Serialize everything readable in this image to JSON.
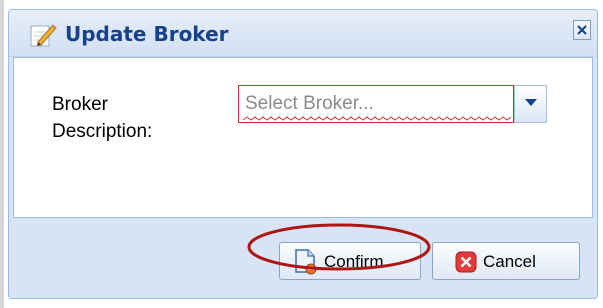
{
  "dialog": {
    "title": "Update Broker",
    "title_icon": "pencil-edit-icon",
    "close_icon": "close-icon"
  },
  "form": {
    "field_label": "Broker Description:",
    "combo_placeholder": "Select Broker...",
    "combo_value": "",
    "combo_trigger_icon": "chevron-down-icon"
  },
  "buttons": {
    "confirm_label": "Confirm",
    "confirm_icon": "document-confirm-icon",
    "cancel_label": "Cancel",
    "cancel_icon": "cancel-x-icon"
  },
  "colors": {
    "title_text": "#15428b",
    "dialog_border": "#99bbe8",
    "dialog_bg": "#d8e4f3",
    "invalid_border": "#cc3333",
    "annotation_ellipse": "#b01515"
  }
}
